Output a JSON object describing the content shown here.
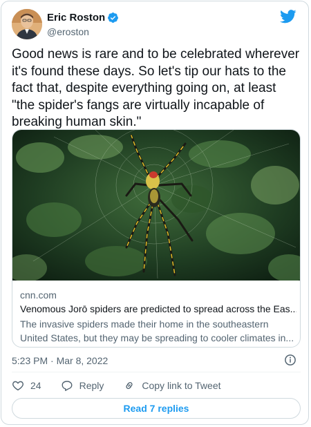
{
  "author": {
    "name": "Eric Roston",
    "handle": "@eroston",
    "verified": true
  },
  "tweet": {
    "text": "Good news is rare and to be celebrated wherever it's found these days. So let's tip our hats to the fact that, despite everything going on, at least \"the spider's fangs are virtually incapable of breaking human skin.\""
  },
  "link_card": {
    "domain": "cnn.com",
    "title": "Venomous Jorō spiders are predicted to spread across the Eas...",
    "description": "The invasive spiders made their home in the southeastern United States, but they may be spreading to cooler climates in..."
  },
  "meta": {
    "timestamp": "5:23 PM · Mar 8, 2022"
  },
  "actions": {
    "like_count": "24",
    "reply_label": "Reply",
    "copy_link_label": "Copy link to Tweet"
  },
  "footer": {
    "read_replies_label": "Read 7 replies"
  },
  "colors": {
    "twitter_blue": "#1d9bf0",
    "secondary_text": "#536471",
    "border": "#cfd9de"
  },
  "icons": [
    "verified-badge-icon",
    "twitter-bird-icon",
    "info-icon",
    "heart-icon",
    "reply-bubble-icon",
    "link-icon"
  ]
}
